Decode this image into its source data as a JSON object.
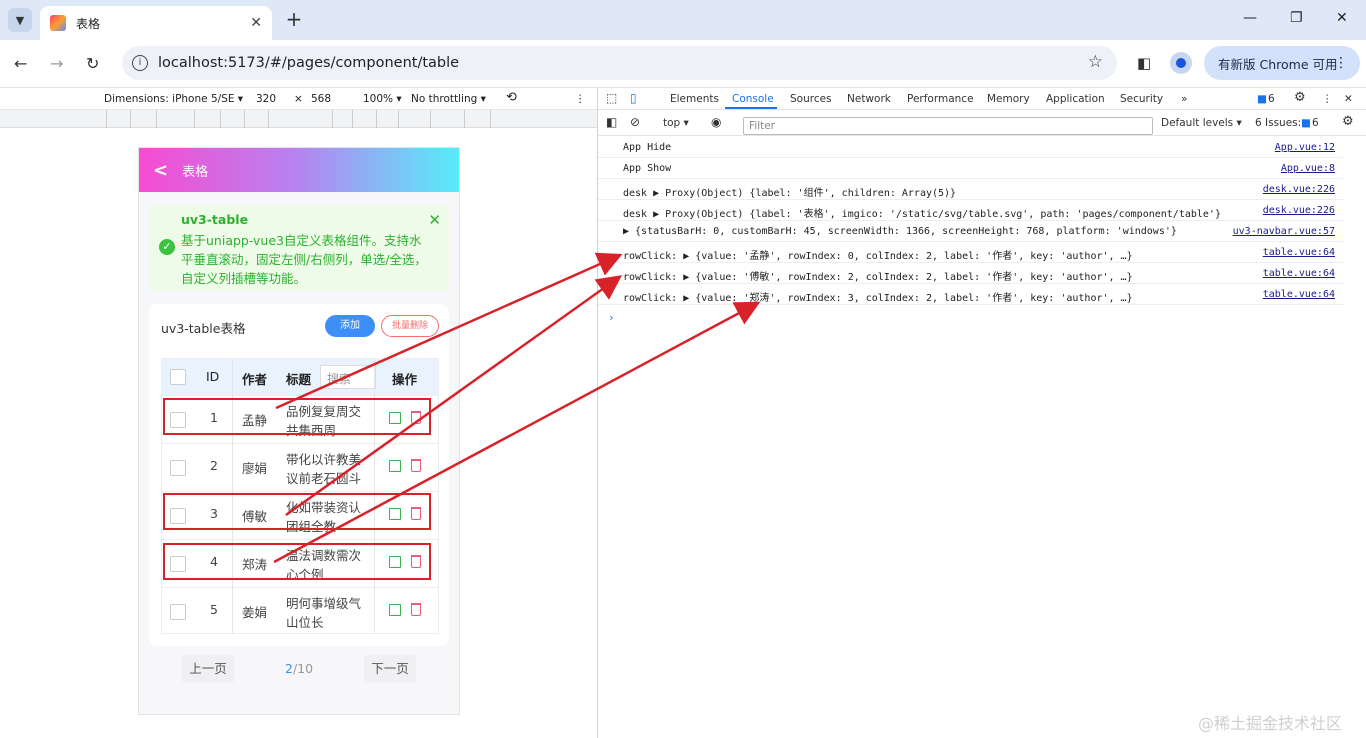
{
  "browser": {
    "tab_title": "表格",
    "url": "localhost:5173/#/pages/component/table",
    "update_label": "有新版 Chrome 可用"
  },
  "device_toolbar": {
    "dimensions": "Dimensions: iPhone 5/SE ▾",
    "width": "320",
    "times": "×",
    "height": "568",
    "zoom": "100% ▾",
    "throttle": "No throttling ▾"
  },
  "phone": {
    "nav_title": "表格",
    "notice_title": "uv3-table",
    "notice_text": "基于uniapp-vue3自定义表格组件。支持水平垂直滚动，固定左侧/右侧列，单选/全选，自定义列插槽等功能。",
    "card_title": "uv3-table表格",
    "add_label": "添加",
    "batch_delete_label": "批量删除",
    "headers": {
      "id": "ID",
      "author": "作者",
      "title": "标题",
      "search_placeholder": "搜索",
      "actions": "操作"
    },
    "rows": [
      {
        "id": "1",
        "author": "孟静",
        "title1": "品例复复周交",
        "title2": "共集西周"
      },
      {
        "id": "2",
        "author": "廖娟",
        "title1": "带化以许教美",
        "title2": "议前老石圆斗"
      },
      {
        "id": "3",
        "author": "傅敏",
        "title1": "化如带装资认",
        "title2": "团组全教"
      },
      {
        "id": "4",
        "author": "郑涛",
        "title1": "温法调数需次",
        "title2": "心个例"
      },
      {
        "id": "5",
        "author": "姜娟",
        "title1": "明何事增级气",
        "title2": "山位长"
      }
    ],
    "pager": {
      "prev": "上一页",
      "current": "2",
      "total": "/10",
      "next": "下一页"
    }
  },
  "devtools": {
    "tabs": [
      "Elements",
      "Console",
      "Sources",
      "Network",
      "Performance",
      "Memory",
      "Application",
      "Security"
    ],
    "issues_badge": "6",
    "context": "top ▾",
    "filter_placeholder": "Filter",
    "levels": "Default levels ▾",
    "issues_label": "6 Issues:",
    "issues_count": "6",
    "logs": [
      {
        "msg": "App Hide",
        "src": "App.vue:12"
      },
      {
        "msg": "App Show",
        "src": "App.vue:8"
      },
      {
        "msg": "desk  ▶ Proxy(Object) {label: '组件', children: Array(5)}",
        "src": "desk.vue:226"
      },
      {
        "msg": "desk  ▶ Proxy(Object) {label: '表格', imgico: '/static/svg/table.svg', path: 'pages/component/table'}",
        "src": "desk.vue:226"
      },
      {
        "msg": "▶ {statusBarH: 0, customBarH: 45, screenWidth: 1366, screenHeight: 768, platform: 'windows'}",
        "src": "uv3-navbar.vue:57"
      },
      {
        "msg": "rowClick:   ▶ {value: '孟静', rowIndex: 0, colIndex: 2, label: '作者', key: 'author', …}",
        "src": "table.vue:64"
      },
      {
        "msg": "rowClick:   ▶ {value: '傅敏', rowIndex: 2, colIndex: 2, label: '作者', key: 'author', …}",
        "src": "table.vue:64"
      },
      {
        "msg": "rowClick:   ▶ {value: '郑涛', rowIndex: 3, colIndex: 2, label: '作者', key: 'author', …}",
        "src": "table.vue:64"
      }
    ]
  },
  "watermark": "@稀土掘金技术社区",
  "colors": {
    "accent": "#1a73e8",
    "annotation": "#d8222a",
    "success": "#2fb030"
  }
}
